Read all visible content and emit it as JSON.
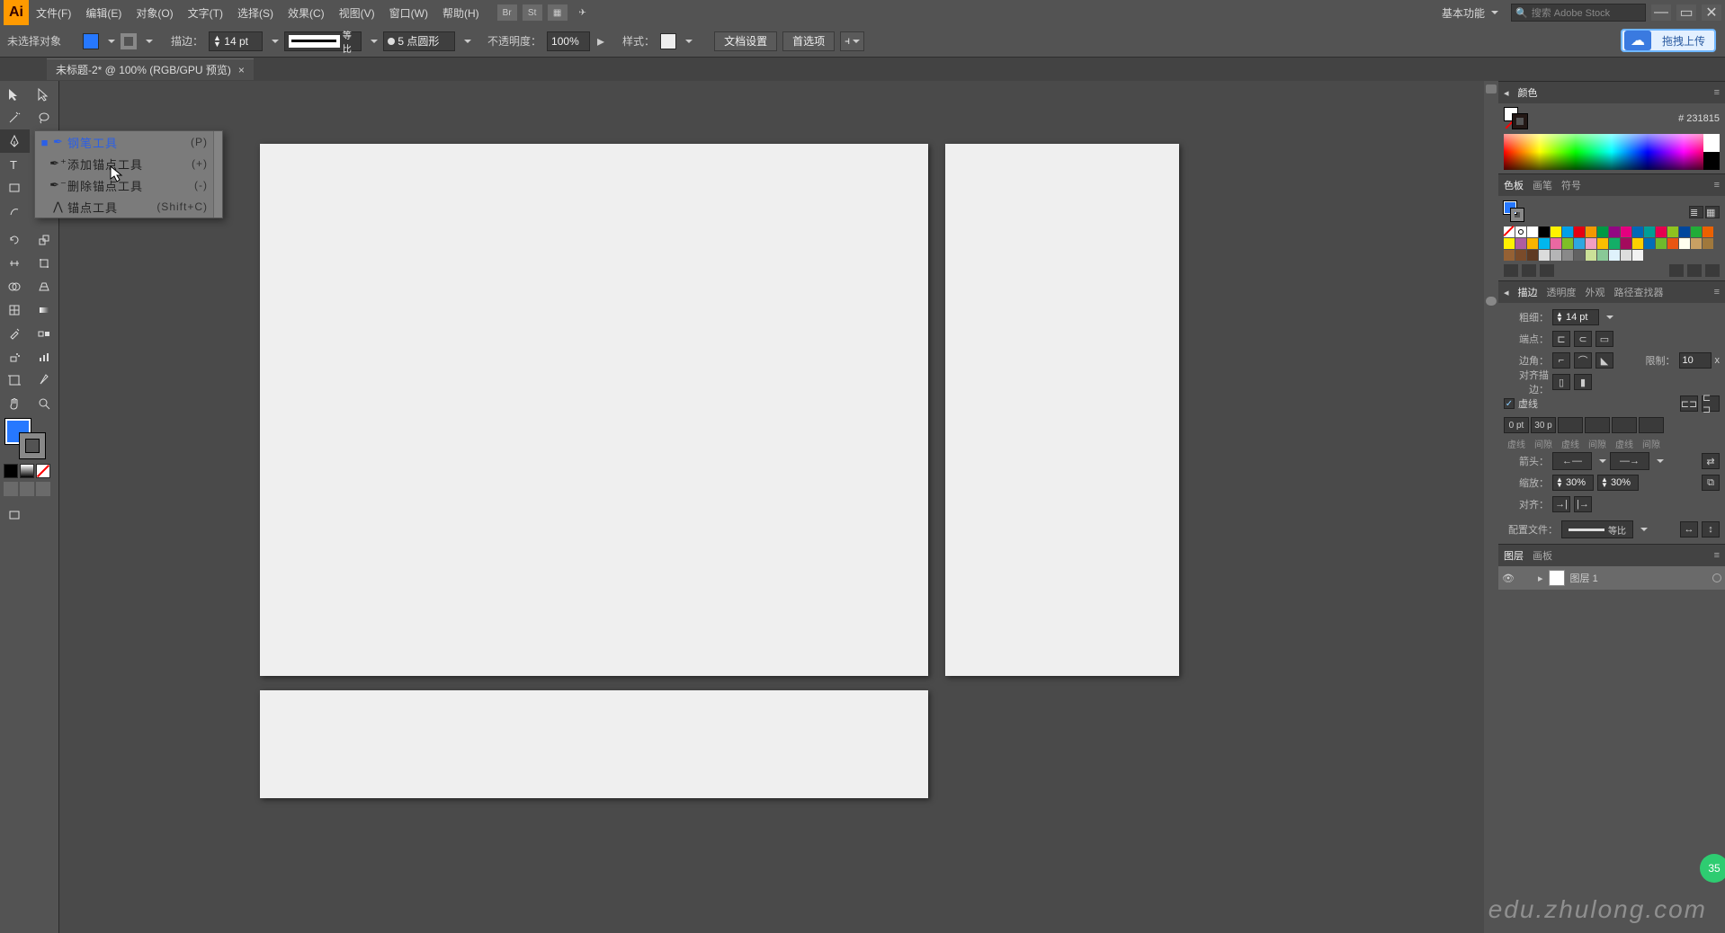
{
  "menubar": {
    "items": [
      "文件(F)",
      "编辑(E)",
      "对象(O)",
      "文字(T)",
      "选择(S)",
      "效果(C)",
      "视图(V)",
      "窗口(W)",
      "帮助(H)"
    ],
    "workspace": "基本功能",
    "search_placeholder": "搜索 Adobe Stock"
  },
  "controlbar": {
    "selection": "未选择对象",
    "stroke_label": "描边：",
    "stroke_pt": "14 pt",
    "stroke_profile": "等比",
    "brush_label": "5 点圆形",
    "opacity_label": "不透明度：",
    "opacity_val": "100%",
    "style_label": "样式：",
    "doc_setup": "文档设置",
    "prefs": "首选项",
    "cloud_label": "拖拽上传"
  },
  "tab": {
    "title": "未标题-2* @ 100% (RGB/GPU 预览)"
  },
  "flyout": {
    "items": [
      {
        "label": "钢笔工具",
        "shortcut": "(P)",
        "active": true
      },
      {
        "label": "添加锚点工具",
        "shortcut": "(+)",
        "active": false
      },
      {
        "label": "删除锚点工具",
        "shortcut": "(-)",
        "active": false
      },
      {
        "label": "锚点工具",
        "shortcut": "(Shift+C)",
        "active": false
      }
    ]
  },
  "color_panel": {
    "tab": "颜色",
    "hex": "231815",
    "hash": "#"
  },
  "swatch_panel": {
    "tabs": [
      "色板",
      "画笔",
      "符号"
    ],
    "colors": [
      "none",
      "reg",
      "#ffffff",
      "#000000",
      "#fff100",
      "#00a0e9",
      "#e60012",
      "#f39800",
      "#009944",
      "#920783",
      "#e4007f",
      "#0068b7",
      "#009e96",
      "#e5004f",
      "#8fc31f",
      "#00479d",
      "#22ac38",
      "#eb6100",
      "#fff100",
      "#ae5da1",
      "#f7b500",
      "#00b7ee",
      "#ea68a2",
      "#7fbe26",
      "#2ea7e0",
      "#f19ec2",
      "#fabe00",
      "#13ae67",
      "#a40b5d",
      "#fdd000",
      "#036eb8",
      "#6fba2c",
      "#e95513",
      "#fffeee",
      "#c9a063",
      "#a0783c",
      "#956134",
      "#7a4b2a",
      "#5f3a22",
      "#dbdcdc",
      "#b5b5b6",
      "#898989",
      "#626262",
      "#cce198",
      "#89c997",
      "#dff2fc",
      "#dddddd",
      "#f2f2f2"
    ]
  },
  "stroke_panel": {
    "tabs": [
      "描边",
      "透明度",
      "外观",
      "路径查找器"
    ],
    "weight_label": "粗细：",
    "weight_val": "14 pt",
    "cap_label": "端点：",
    "corner_label": "边角：",
    "limit_label": "限制：",
    "limit_val": "10",
    "x": "x",
    "align_label": "对齐描边：",
    "dashed_label": "虚线",
    "dash_vals": [
      "0 pt",
      "30 p",
      "",
      "",
      "",
      ""
    ],
    "dash_heads": [
      "虚线",
      "间隙",
      "虚线",
      "间隙",
      "虚线",
      "间隙"
    ],
    "arrow_label": "箭头：",
    "scale_label": "缩放：",
    "scale_a": "30%",
    "scale_b": "30%",
    "align2_label": "对齐：",
    "profile_label": "配置文件："
  },
  "layers_panel": {
    "tabs": [
      "图层",
      "画板"
    ],
    "layer_name": "图层 1"
  },
  "watermark": "edu.zhulong.com",
  "badge": "35"
}
